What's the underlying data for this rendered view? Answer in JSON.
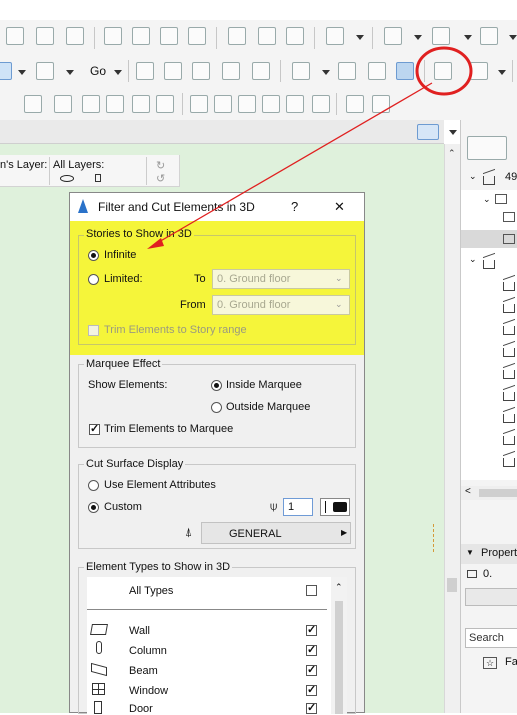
{
  "toolbar": {
    "go_label": "Go"
  },
  "layers_bar": {
    "layer_label": "n's Layer:",
    "all_layers_label": "All Layers:"
  },
  "dialog": {
    "title": "Filter and Cut Elements in 3D",
    "help": "?",
    "close": "✕",
    "stories": {
      "group_title": "Stories to Show in 3D",
      "infinite_label": "Infinite",
      "limited_label": "Limited:",
      "to_label": "To",
      "from_label": "From",
      "to_value": "0. Ground floor",
      "from_value": "0. Ground floor",
      "trim_label": "Trim Elements to Story range",
      "selected": "infinite"
    },
    "marquee": {
      "group_title": "Marquee Effect",
      "show_label": "Show Elements:",
      "inside_label": "Inside Marquee",
      "outside_label": "Outside Marquee",
      "trim_label": "Trim Elements to Marquee",
      "selected": "inside",
      "trim_checked": true
    },
    "cut_surface": {
      "group_title": "Cut Surface Display",
      "use_attr_label": "Use Element Attributes",
      "custom_label": "Custom",
      "pen_value": "1",
      "general_label": "GENERAL",
      "selected": "custom"
    },
    "element_types": {
      "group_title": "Element Types to Show in 3D",
      "all_types_label": "All Types",
      "items": [
        {
          "label": "Wall",
          "icon": "wall-icon",
          "checked": true
        },
        {
          "label": "Column",
          "icon": "column-icon",
          "checked": true
        },
        {
          "label": "Beam",
          "icon": "beam-icon",
          "checked": true
        },
        {
          "label": "Window",
          "icon": "window-icon",
          "checked": true
        },
        {
          "label": "Door",
          "icon": "door-icon",
          "checked": true
        }
      ]
    }
  },
  "navigator": {
    "tree_root_label": "49",
    "properties_label": "Propert",
    "properties_value": "0.",
    "search_placeholder": "Search",
    "fav_label": "Fa"
  },
  "colors": {
    "highlight": "#f5f53a",
    "annotation_red": "#e02020",
    "canvas_green": "#dff1dc"
  }
}
